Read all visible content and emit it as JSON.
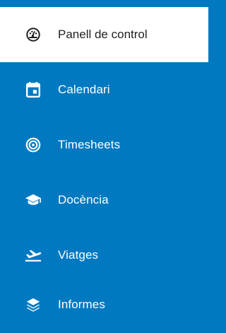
{
  "sidebar": {
    "items": [
      {
        "label": "Panell de control",
        "icon": "dashboard-gauge-icon",
        "active": true
      },
      {
        "label": "Calendari",
        "icon": "calendar-icon",
        "active": false
      },
      {
        "label": "Timesheets",
        "icon": "target-icon",
        "active": false
      },
      {
        "label": "Docència",
        "icon": "graduation-cap-icon",
        "active": false
      },
      {
        "label": "Viatges",
        "icon": "airplane-departure-icon",
        "active": false
      },
      {
        "label": "Informes",
        "icon": "layers-icon",
        "active": false
      }
    ]
  },
  "colors": {
    "sidebar_background": "#0079c1",
    "active_background": "#ffffff",
    "active_text": "#222222",
    "inactive_text": "#ffffff"
  }
}
